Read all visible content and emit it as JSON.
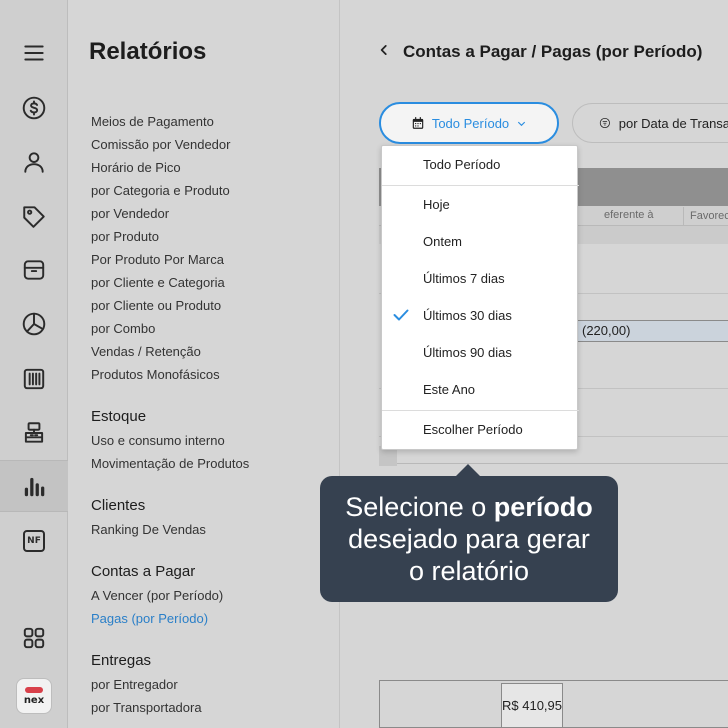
{
  "rail": {
    "items": [
      "menu-icon",
      "dollar-circle-icon",
      "user-icon",
      "tag-icon",
      "box-icon",
      "pie-chart-icon",
      "barcode-icon",
      "cash-register-icon",
      "bar-chart-icon",
      "nf-icon",
      "grid-icon",
      "nex-logo"
    ],
    "nf_label": "NF",
    "logo_text": "nex"
  },
  "panel": {
    "title": "Relatórios",
    "sales_items": [
      "Meios de Pagamento",
      "Comissão por Vendedor",
      "Horário de Pico",
      "por Categoria e Produto",
      "por Vendedor",
      "por Produto",
      "Por Produto Por Marca",
      "por Cliente e Categoria",
      "por Cliente ou Produto",
      "por Combo",
      "Vendas / Retenção",
      "Produtos Monofásicos"
    ],
    "estoque": {
      "title": "Estoque",
      "items": [
        "Uso e consumo interno",
        "Movimentação de Produtos"
      ]
    },
    "clientes": {
      "title": "Clientes",
      "items": [
        "Ranking De Vendas"
      ]
    },
    "contas": {
      "title": "Contas a Pagar",
      "items": [
        "A Vencer (por Período)",
        "Pagas (por Período)"
      ]
    },
    "entregas": {
      "title": "Entregas",
      "items": [
        "por Entregador",
        "por Transportadora"
      ]
    }
  },
  "main": {
    "back_icon": "chevron-left-icon",
    "title": "Contas a Pagar / Pagas (por Período)",
    "period_button": "Todo Período",
    "filter_button": "por Data de Transação",
    "table": {
      "col_referente": "eferente à",
      "col_favorecido": "Favorec",
      "amount": "(220,00)",
      "total": "R$ 410,95"
    }
  },
  "dropdown": {
    "options": [
      "Todo Período",
      "Hoje",
      "Ontem",
      "Últimos 7 dias",
      "Últimos 30 dias",
      "Últimos 90 dias",
      "Este Ano",
      "Escolher Período"
    ],
    "selected": "Últimos 30 dias"
  },
  "tooltip": {
    "line1_pre": "Selecione o ",
    "line1_bold": "período",
    "line2": "desejado para gerar",
    "line3": "o relatório"
  },
  "colors": {
    "accent": "#2a8de0",
    "tooltip_bg": "#364150",
    "logo_red": "#d8404a"
  }
}
